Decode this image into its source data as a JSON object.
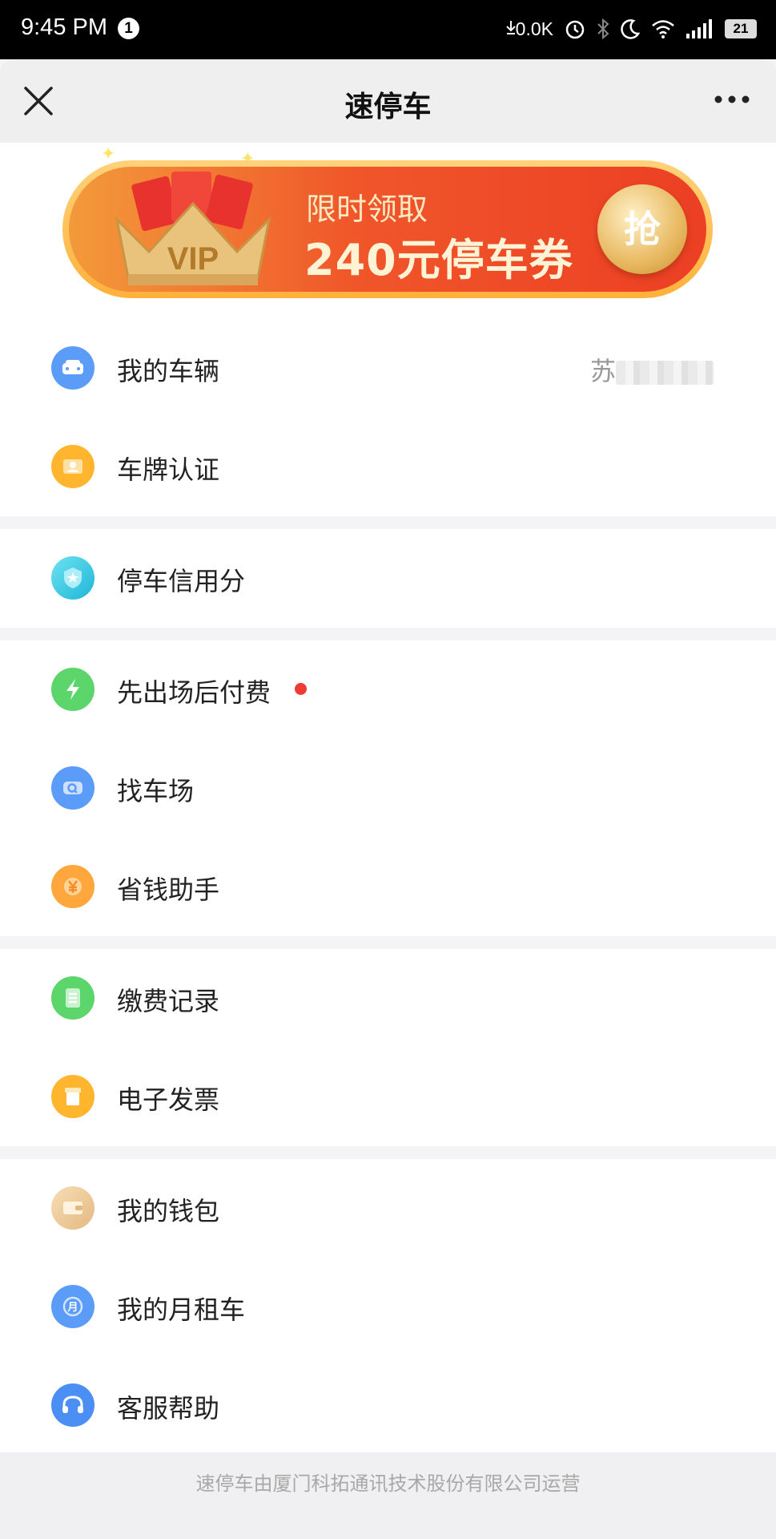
{
  "status_bar": {
    "time": "9:45 PM",
    "notification_badge": "1",
    "network_speed": "0.0K",
    "battery": "21"
  },
  "header": {
    "title": "速停车"
  },
  "banner": {
    "subtitle": "限时领取",
    "headline": "240元停车券",
    "button_label": "抢",
    "crown_text": "VIP",
    "colors": {
      "start": "#f39a3a",
      "end": "#ec3f24",
      "border": "#ffc862"
    }
  },
  "menu": {
    "vehicle": {
      "label": "我的车辆",
      "value_prefix": "苏",
      "icon": "car-icon",
      "color": "#5b9cf8"
    },
    "plate_auth": {
      "label": "车牌认证",
      "icon": "id-card-icon",
      "color": "#ffb62e"
    },
    "credit": {
      "label": "停车信用分",
      "icon": "shield-star-icon",
      "color": "#36c6e0"
    },
    "pay_later": {
      "label": "先出场后付费",
      "icon": "lightning-icon",
      "color": "#5cd66a"
    },
    "find_lot": {
      "label": "找车场",
      "icon": "search-car-icon",
      "color": "#5b9cf8"
    },
    "savings": {
      "label": "省钱助手",
      "icon": "yuan-coin-icon",
      "color": "#ffa63c"
    },
    "payments": {
      "label": "缴费记录",
      "icon": "list-icon",
      "color": "#5cd66a"
    },
    "invoice": {
      "label": "电子发票",
      "icon": "invoice-icon",
      "color": "#ffb62e"
    },
    "wallet": {
      "label": "我的钱包",
      "icon": "wallet-icon",
      "color": "#ecc88f"
    },
    "monthly": {
      "label": "我的月租车",
      "icon": "month-icon",
      "color": "#5b9cf8",
      "icon_char": "月"
    },
    "support": {
      "label": "客服帮助",
      "icon": "headset-icon",
      "color": "#4b8ff5"
    }
  },
  "footer": {
    "text": "速停车由厦门科拓通讯技术股份有限公司运营"
  }
}
